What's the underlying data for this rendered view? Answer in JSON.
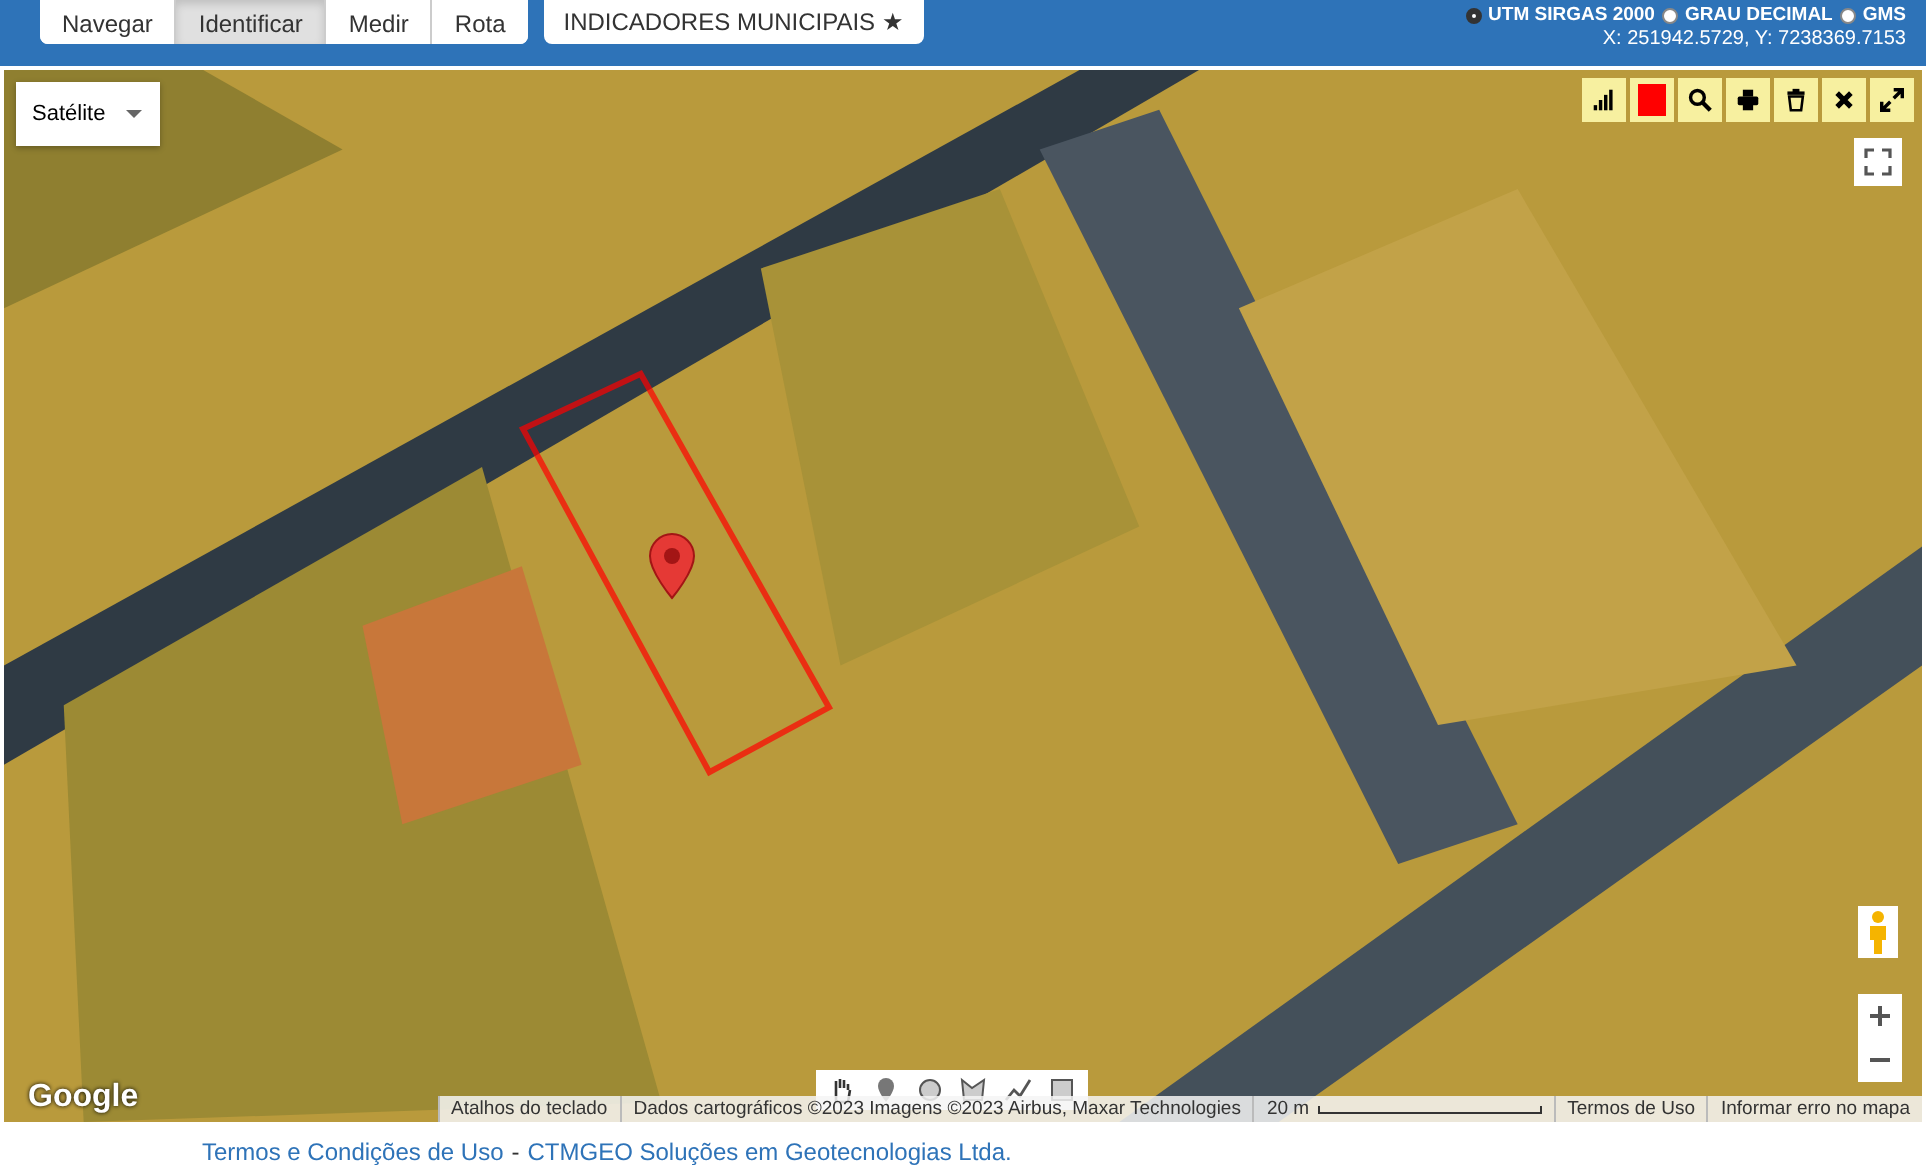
{
  "toolbar": {
    "modes": [
      {
        "label": "Navegar",
        "selected": false
      },
      {
        "label": "Identificar",
        "selected": true
      },
      {
        "label": "Medir",
        "selected": false
      },
      {
        "label": "Rota",
        "selected": false
      }
    ],
    "indicators_button": "INDICADORES MUNICIPAIS ★"
  },
  "coordinate_systems": [
    {
      "label": "UTM SIRGAS 2000",
      "selected": true
    },
    {
      "label": "GRAU DECIMAL",
      "selected": false
    },
    {
      "label": "GMS",
      "selected": false
    }
  ],
  "coordinates": "X: 251942.5729, Y: 7238369.7153",
  "map": {
    "map_type": "Satélite",
    "logo": "Google",
    "attribution": [
      "Atalhos do teclado",
      "Dados cartográficos ©2023 Imagens ©2023 Airbus, Maxar Technologies"
    ],
    "scale": "20 m",
    "links": [
      "Termos de Uso",
      "Informar erro no mapa"
    ]
  },
  "footer": {
    "terms_link": "Termos e Condições de Uso",
    "separator": "-",
    "company_link": "CTMGEO Soluções em Geotecnologias Ltda."
  }
}
